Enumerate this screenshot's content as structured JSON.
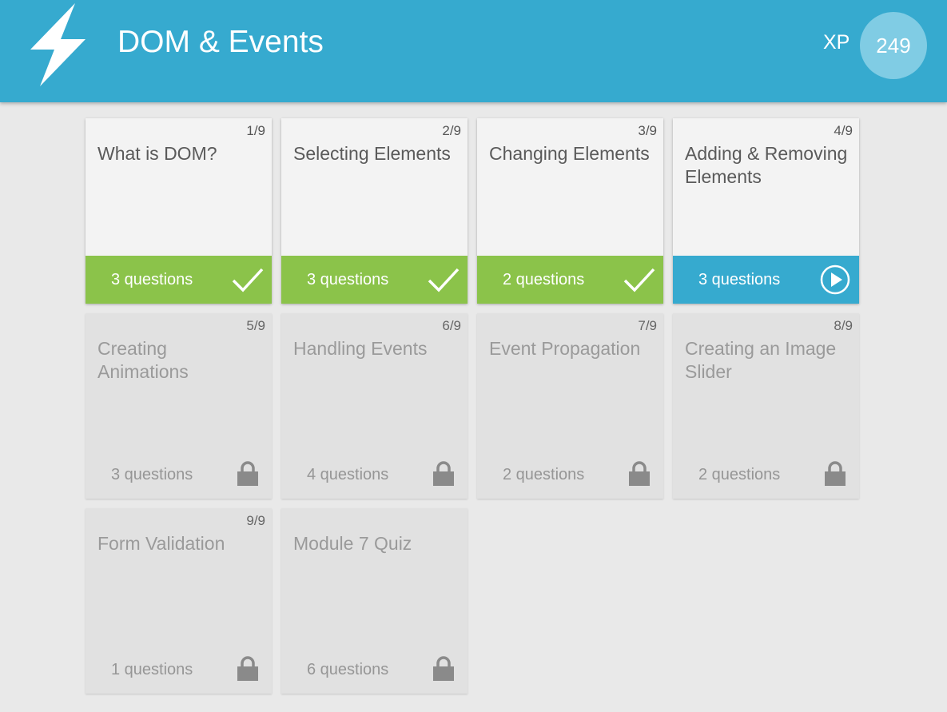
{
  "header": {
    "title": "DOM & Events",
    "xp_label": "XP",
    "xp_value": "249",
    "icon": "lightning-bolt-icon"
  },
  "colors": {
    "header": "#36aacf",
    "completed": "#8bc34a",
    "current": "#36aacf",
    "locked": "#e1e1e1"
  },
  "lessons": [
    {
      "number": "1/9",
      "title": "What is DOM?",
      "questions": "3 questions",
      "status": "completed",
      "icon": "checkmark-icon"
    },
    {
      "number": "2/9",
      "title": "Selecting Elements",
      "questions": "3 questions",
      "status": "completed",
      "icon": "checkmark-icon"
    },
    {
      "number": "3/9",
      "title": "Changing Elements",
      "questions": "2 questions",
      "status": "completed",
      "icon": "checkmark-icon"
    },
    {
      "number": "4/9",
      "title": "Adding & Removing Elements",
      "questions": "3 questions",
      "status": "current",
      "icon": "play-icon"
    },
    {
      "number": "5/9",
      "title": "Creating Animations",
      "questions": "3 questions",
      "status": "locked",
      "icon": "lock-icon"
    },
    {
      "number": "6/9",
      "title": "Handling Events",
      "questions": "4 questions",
      "status": "locked",
      "icon": "lock-icon"
    },
    {
      "number": "7/9",
      "title": "Event Propagation",
      "questions": "2 questions",
      "status": "locked",
      "icon": "lock-icon"
    },
    {
      "number": "8/9",
      "title": "Creating an Image Slider",
      "questions": "2 questions",
      "status": "locked",
      "icon": "lock-icon"
    },
    {
      "number": "9/9",
      "title": "Form Validation",
      "questions": "1 questions",
      "status": "locked",
      "icon": "lock-icon"
    },
    {
      "number": "",
      "title": "Module 7 Quiz",
      "questions": "6 questions",
      "status": "locked",
      "icon": "lock-icon"
    }
  ]
}
